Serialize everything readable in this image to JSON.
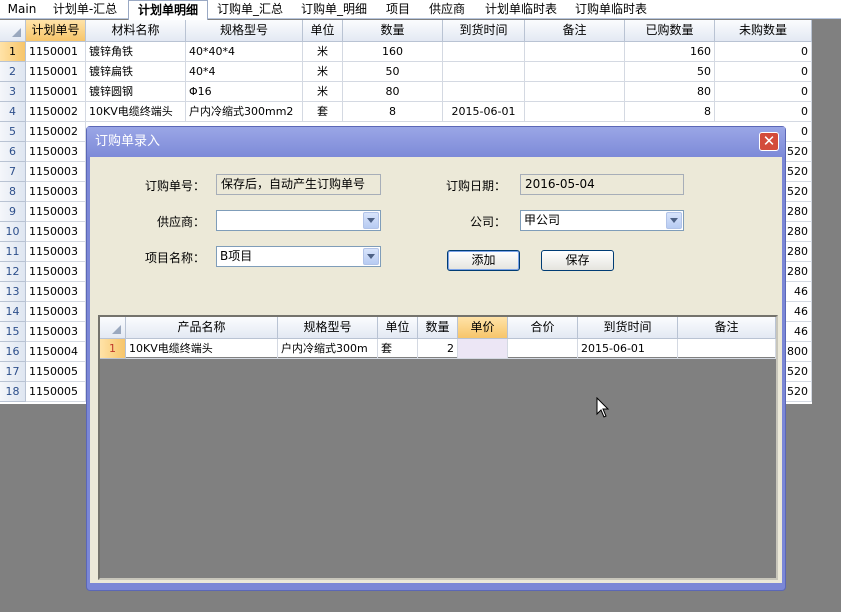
{
  "tabs": [
    "Main",
    "计划单-汇总",
    "计划单明细",
    "订购单_汇总",
    "订购单_明细",
    "项目",
    "供应商",
    "计划单临时表",
    "订购单临时表"
  ],
  "active_tab": 2,
  "grid": {
    "headers": [
      "计划单号",
      "材料名称",
      "规格型号",
      "单位",
      "数量",
      "到货时间",
      "备注",
      "已购数量",
      "未购数量"
    ],
    "row_numbers": [
      "1",
      "2",
      "3",
      "4",
      "5",
      "6",
      "7",
      "8",
      "9",
      "10",
      "11",
      "12",
      "13",
      "14",
      "15",
      "16",
      "17",
      "18"
    ],
    "plan_numbers": [
      "1150001",
      "1150001",
      "1150001",
      "1150002",
      "1150002",
      "1150003",
      "1150003",
      "1150003",
      "1150003",
      "1150003",
      "1150003",
      "1150003",
      "1150003",
      "1150003",
      "1150003",
      "1150004",
      "1150005",
      "1150005"
    ],
    "rows_full": [
      {
        "name": "镀锌角铁",
        "spec": "40*40*4",
        "unit": "米",
        "qty": "160",
        "date": "",
        "note": "",
        "bought": "160",
        "unbought": "0"
      },
      {
        "name": "镀锌扁铁",
        "spec": "40*4",
        "unit": "米",
        "qty": "50",
        "date": "",
        "note": "",
        "bought": "50",
        "unbought": "0"
      },
      {
        "name": "镀锌圆钢",
        "spec": "Φ16",
        "unit": "米",
        "qty": "80",
        "date": "",
        "note": "",
        "bought": "80",
        "unbought": "0"
      },
      {
        "name": "10KV电缆终端头",
        "spec": "户内冷缩式300mm2",
        "unit": "套",
        "qty": "8",
        "date": "2015-06-01",
        "note": "",
        "bought": "8",
        "unbought": "0"
      }
    ],
    "right_values": [
      "0",
      "520",
      "520",
      "520",
      "280",
      "280",
      "280",
      "280",
      "46",
      "46",
      "46",
      "800",
      "520",
      "520"
    ]
  },
  "dialog": {
    "title": "订购单录入",
    "order_no_label": "订购单号：",
    "order_no_value": "保存后，自动产生订购单号",
    "order_date_label": "订购日期：",
    "order_date_value": "2016-05-04",
    "supplier_label": "供应商：",
    "supplier_value": "",
    "company_label": "公司：",
    "company_value": "甲公司",
    "project_label": "项目名称：",
    "project_value": "B项目",
    "add_button": "添加",
    "save_button": "保存",
    "close_glyph": "✕",
    "sub_grid": {
      "headers": [
        "产品名称",
        "规格型号",
        "单位",
        "数量",
        "单价",
        "合价",
        "到货时间",
        "备注"
      ],
      "rows": [
        {
          "num": "1",
          "name": "10KV电缆终端头",
          "spec": "户内冷缩式300m",
          "unit": "套",
          "qty": "2",
          "price": "",
          "total": "",
          "date": "2015-06-01",
          "note": ""
        }
      ]
    }
  },
  "colors": {
    "dialog_frame": "#7b87d6",
    "dialog_body": "#ece9d8",
    "selected_header": "#f7c56a",
    "background": "#808080"
  }
}
